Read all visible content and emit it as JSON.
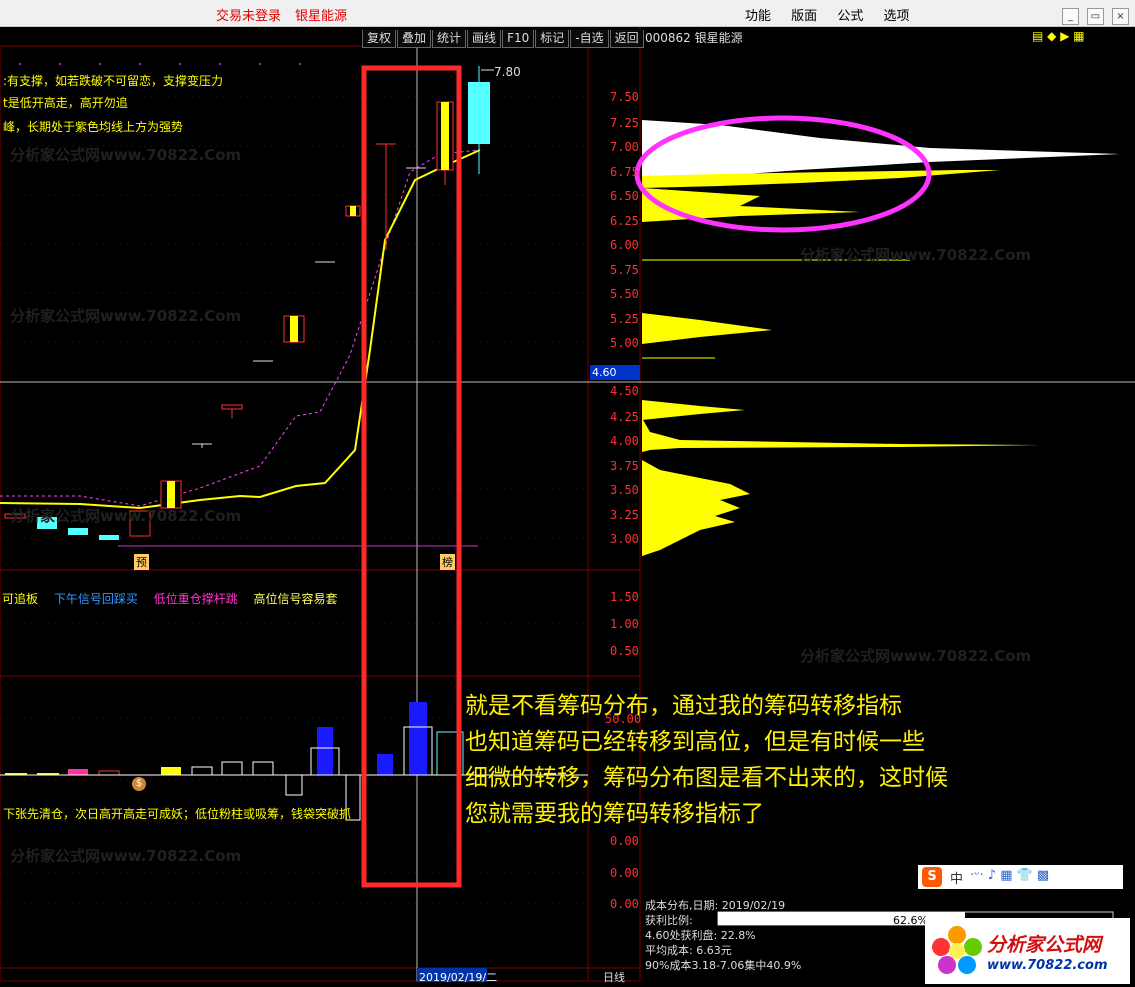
{
  "topbar": {
    "login": "交易未登录",
    "stock_name": "银星能源",
    "menu": [
      "功能",
      "版面",
      "公式",
      "选项"
    ]
  },
  "toolbar": [
    "复权",
    "叠加",
    "统计",
    "画线",
    "F10",
    "标记",
    "-自选",
    "返回"
  ],
  "header_code": "000862 银星能源",
  "notes": [
    ":有支撑，如若跌破不可留恋，支撑变压力",
    "t是低开高走，高开勿追",
    "峰，长期处于紫色均线上方为强势"
  ],
  "price_axis": [
    "7.50",
    "7.25",
    "7.00",
    "6.75",
    "6.50",
    "6.25",
    "6.00",
    "5.75",
    "5.50",
    "5.25",
    "5.00",
    "4.50",
    "4.25",
    "4.00",
    "3.75",
    "3.50",
    "3.25",
    "3.00"
  ],
  "high_label": "7.80",
  "current_price": "4.60",
  "markers": {
    "yu": "预",
    "bang": "榜",
    "money": "$"
  },
  "indicator_labels": [
    "可追板",
    "下午信号回踩买",
    "低位重仓撑杆跳",
    "高位信号容易套"
  ],
  "indicator_colors": [
    "#ffff00",
    "#3399ff",
    "#ff33cc",
    "#ffff66"
  ],
  "ind_axis": [
    "1.50",
    "1.00",
    "0.50"
  ],
  "vol_axis": [
    "50.00",
    "0.00",
    "0.00",
    "0.00"
  ],
  "bottom_note": "下张先清仓，次日高开高走可成妖；低位粉柱或吸筹，钱袋突破抓",
  "date_label": "2019/02/19/二",
  "period_label": "日线",
  "annotation": [
    "就是不看筹码分布，通过我的筹码转移指标",
    "也知道筹码已经转移到高位，但是有时候一些",
    "细微的转移，筹码分布图是看不出来的，这时候",
    "您就需要我的筹码转移指标了"
  ],
  "cost_info": {
    "title": "成本分布,日期: 2019/02/19",
    "ratio_label": "获利比例:",
    "ratio_value": "62.6%",
    "at_price": "4.60处获利盘: 22.8%",
    "avg": "平均成本: 6.63元",
    "concentration": "90%成本3.18-7.06集中40.9%"
  },
  "watermark": "分析家公式网www.70822.Com",
  "logo": {
    "name": "分析家公式网",
    "url": "www.70822.com"
  },
  "ime": {
    "lang": "中"
  }
}
